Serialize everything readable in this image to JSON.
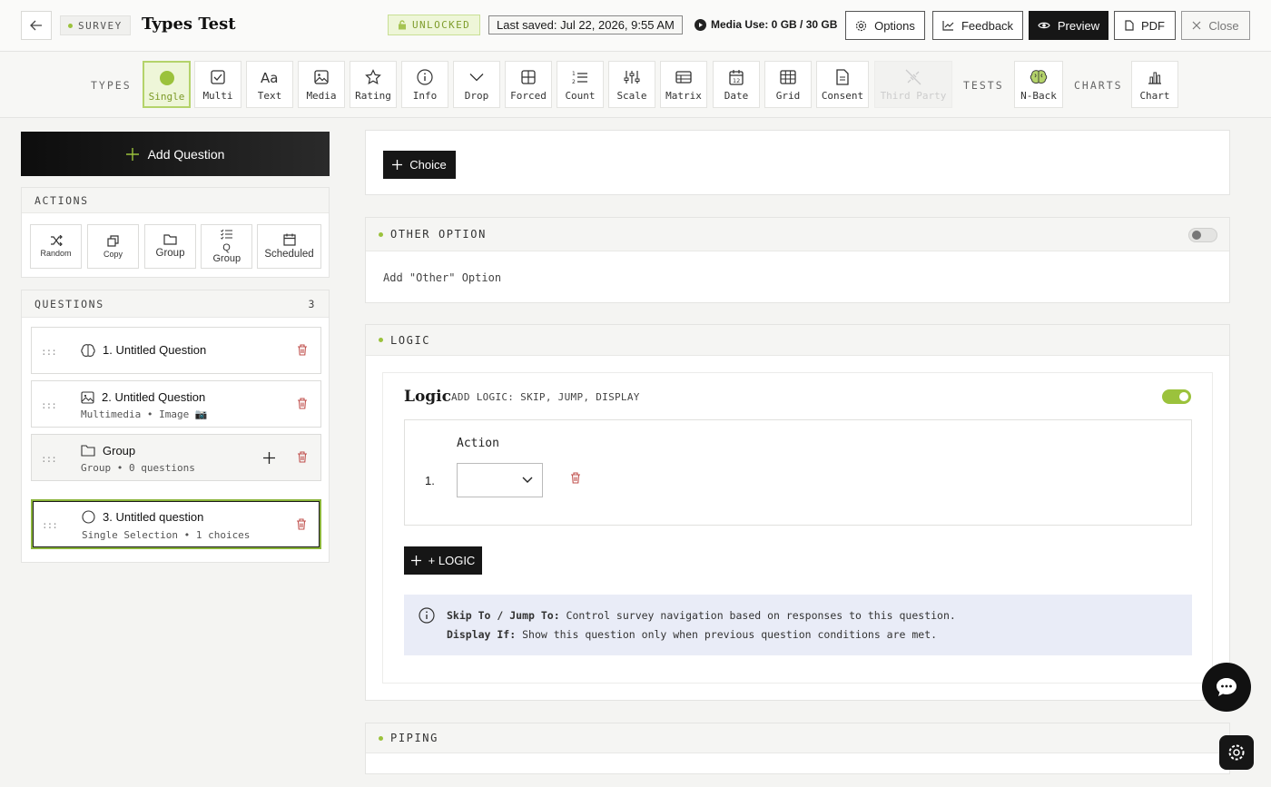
{
  "header": {
    "survey_tag": "SURVEY",
    "title": "Types Test",
    "lock_status": "UNLOCKED",
    "last_saved": "Last saved: Jul 22, 2026, 9:55 AM",
    "media_use": "Media Use: 0 GB / 30 GB",
    "buttons": {
      "options": "Options",
      "feedback": "Feedback",
      "preview": "Preview",
      "pdf": "PDF",
      "close": "Close"
    }
  },
  "types_bar": {
    "types_label": "TYPES",
    "tests_label": "TESTS",
    "charts_label": "CHARTS",
    "types": [
      {
        "label": "Single",
        "icon": "circle-icon",
        "state": "active"
      },
      {
        "label": "Multi",
        "icon": "checkbox-icon"
      },
      {
        "label": "Text",
        "icon": "text-icon"
      },
      {
        "label": "Media",
        "icon": "image-icon"
      },
      {
        "label": "Rating",
        "icon": "star-icon"
      },
      {
        "label": "Info",
        "icon": "info-icon"
      },
      {
        "label": "Drop",
        "icon": "chevron-down-icon"
      },
      {
        "label": "Forced",
        "icon": "grid-icon"
      },
      {
        "label": "Count",
        "icon": "numbered-list-icon"
      },
      {
        "label": "Scale",
        "icon": "sliders-icon"
      },
      {
        "label": "Matrix",
        "icon": "table-icon"
      },
      {
        "label": "Date",
        "icon": "calendar-icon"
      },
      {
        "label": "Grid",
        "icon": "grid-table-icon"
      },
      {
        "label": "Consent",
        "icon": "document-icon"
      },
      {
        "label": "Third Party",
        "icon": "plug-icon",
        "state": "disabled"
      }
    ],
    "tests": [
      {
        "label": "N-Back",
        "icon": "brain-icon"
      }
    ],
    "charts": [
      {
        "label": "Chart",
        "icon": "bar-chart-icon"
      }
    ]
  },
  "left": {
    "add_question": "Add Question",
    "actions_label": "ACTIONS",
    "actions": [
      {
        "label": "Random",
        "icon": "shuffle-icon"
      },
      {
        "label": "Copy",
        "icon": "copy-icon"
      },
      {
        "label": "Group",
        "icon": "folder-icon"
      },
      {
        "label": "Q Group",
        "icon": "list-check-icon"
      },
      {
        "label": "Scheduled",
        "icon": "calendar-icon"
      }
    ],
    "questions_label": "QUESTIONS",
    "questions_count": "3",
    "questions": [
      {
        "title": "1. Untitled Question",
        "subtitle": "",
        "icon": "brain-icon"
      },
      {
        "title": "2. Untitled Question",
        "subtitle": "Multimedia • Image 📷",
        "icon": "image-icon"
      },
      {
        "title": "Group",
        "subtitle": "Group • 0 questions",
        "icon": "folder-icon"
      },
      {
        "title": "3. Untitled question",
        "subtitle": "Single Selection • 1 choices",
        "icon": "circle-icon"
      }
    ]
  },
  "main": {
    "choice_button": "Choice",
    "other_option": {
      "heading": "OTHER OPTION",
      "label": "Add \"Other\" Option",
      "enabled": false
    },
    "logic": {
      "heading": "LOGIC",
      "title": "Logic",
      "subtitle": "ADD LOGIC: SKIP, JUMP, DISPLAY",
      "enabled": true,
      "action_label": "Action",
      "row_number": "1.",
      "add_logic_button": "+ LOGIC",
      "info_skip_label": "Skip To / Jump To:",
      "info_skip_text": " Control survey navigation based on responses to this question.",
      "info_display_label": "Display If:",
      "info_display_text": " Show this question only when previous question conditions are met."
    },
    "piping": {
      "heading": "PIPING"
    }
  },
  "colors": {
    "accent": "#9bc23c",
    "accent_bg": "#eef6d8",
    "dark": "#161616",
    "danger": "#c0504d"
  }
}
